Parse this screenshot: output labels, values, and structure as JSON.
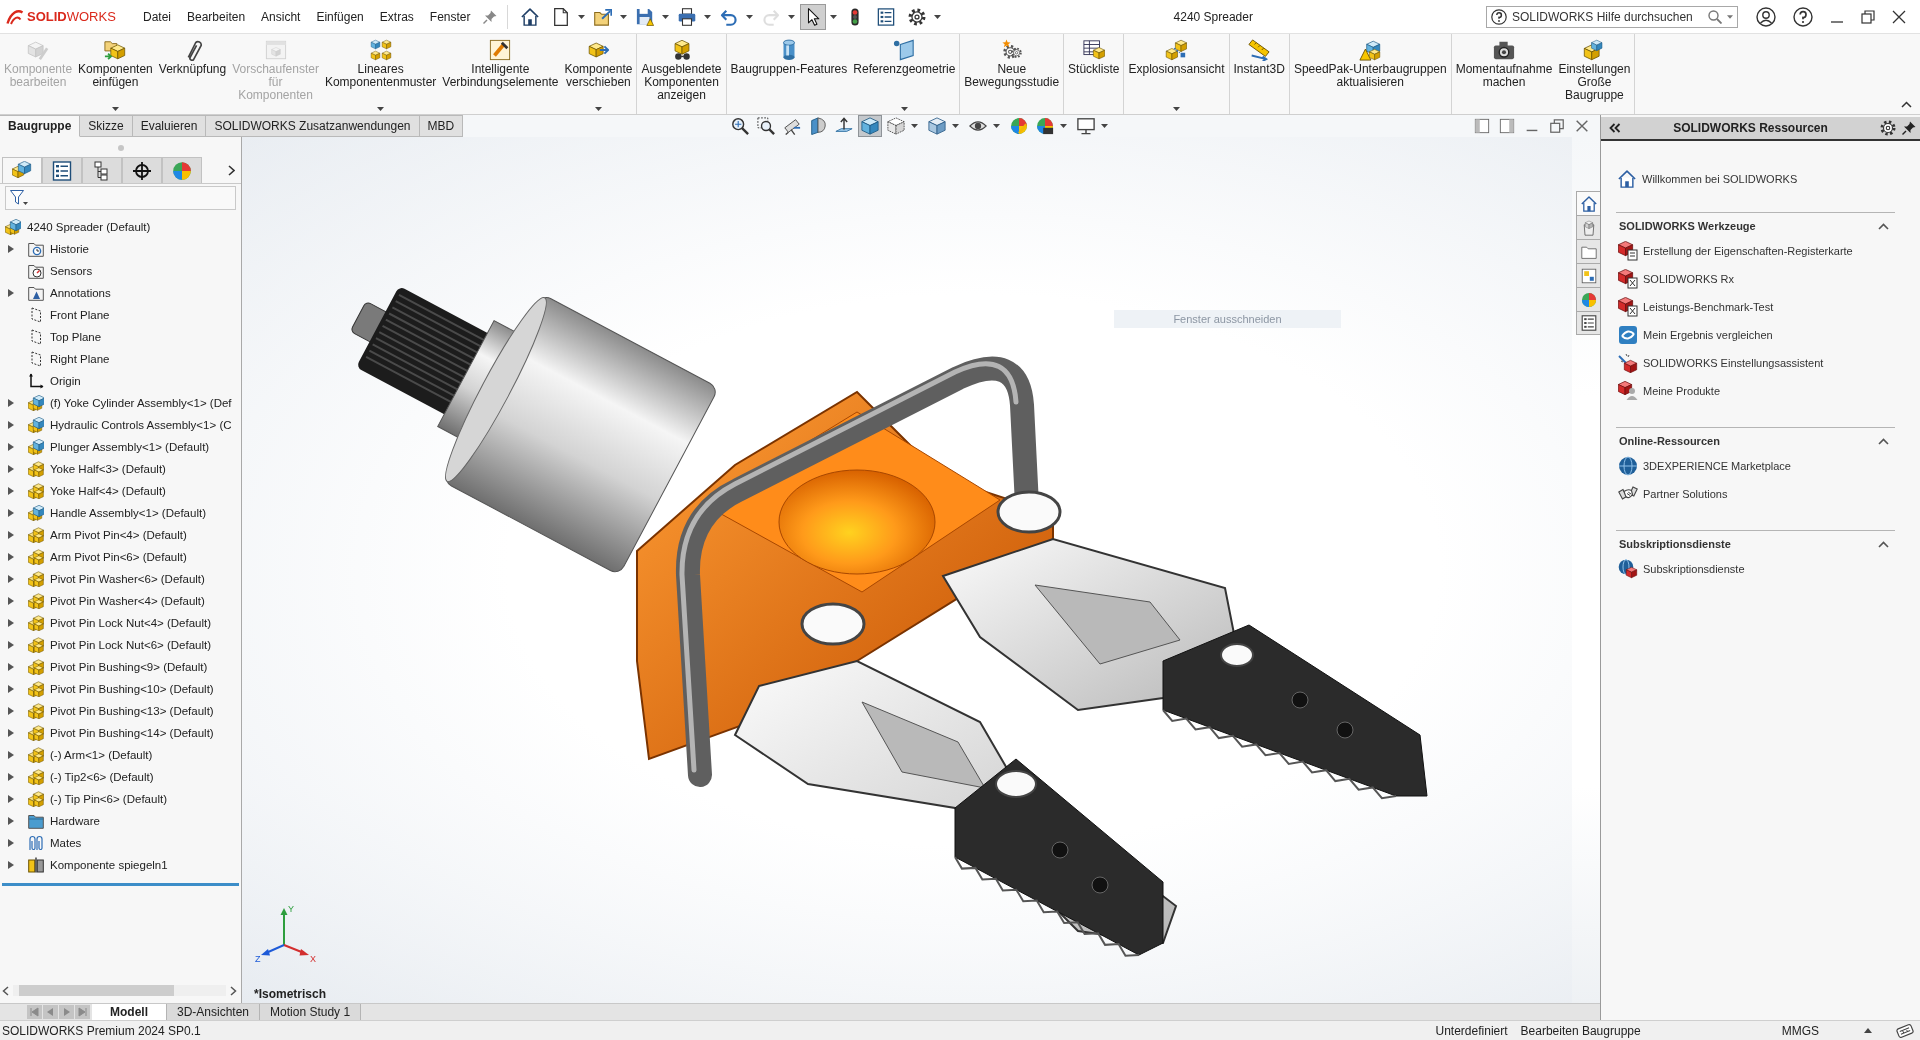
{
  "logo": "**SOLID**WORKS",
  "menu": [
    "Datei",
    "Bearbeiten",
    "Ansicht",
    "Einfügen",
    "Extras",
    "Fenster"
  ],
  "quick_access": [
    {
      "dropdown": false,
      "disabled": false,
      "selected": false
    },
    {
      "dropdown": true,
      "disabled": false,
      "selected": false
    },
    {
      "dropdown": true,
      "disabled": false,
      "selected": false
    },
    {
      "dropdown": true,
      "disabled": false,
      "selected": false
    },
    {
      "dropdown": true,
      "disabled": false,
      "selected": false
    },
    {
      "dropdown": true,
      "disabled": false,
      "selected": false
    },
    {
      "dropdown": true,
      "disabled": true,
      "selected": false
    },
    {
      "dropdown": true,
      "disabled": false,
      "selected": true
    },
    {
      "dropdown": false,
      "disabled": false,
      "selected": false
    },
    {
      "dropdown": false,
      "disabled": false,
      "selected": false
    },
    {
      "dropdown": true,
      "disabled": false,
      "selected": false
    }
  ],
  "window_title": "4240 Spreader",
  "search": {
    "placeholder": "SOLIDWORKS Hilfe durchsuchen"
  },
  "ribbon": {
    "groups": [
      {
        "commands": [
          {
            "label": "Komponente\nbearbeiten",
            "disabled": true,
            "dropdown": false
          },
          {
            "label": "Komponenten\neinfügen",
            "disabled": false,
            "dropdown": true
          },
          {
            "label": "Verknüpfung",
            "disabled": false,
            "dropdown": false
          },
          {
            "label": "Vorschaufenster\nfür\nKomponenten",
            "disabled": true,
            "dropdown": false
          },
          {
            "label": "Lineares\nKomponentenmuster",
            "disabled": false,
            "dropdown": true
          },
          {
            "label": "Intelligente\nVerbindungselemente",
            "disabled": false,
            "dropdown": false
          },
          {
            "label": "Komponente\nverschieben",
            "disabled": false,
            "dropdown": true
          }
        ]
      },
      {
        "commands": [
          {
            "label": "Ausgeblendete\nKomponenten\nanzeigen",
            "disabled": false,
            "dropdown": false
          }
        ]
      },
      {
        "commands": [
          {
            "label": "Baugruppen-Features",
            "disabled": false,
            "dropdown": false
          },
          {
            "label": "Referenzgeometrie",
            "disabled": false,
            "dropdown": true
          }
        ]
      },
      {
        "commands": [
          {
            "label": "Neue\nBewegungsstudie",
            "disabled": false,
            "dropdown": false
          }
        ]
      },
      {
        "commands": [
          {
            "label": "Stückliste",
            "disabled": false,
            "dropdown": false
          }
        ]
      },
      {
        "commands": [
          {
            "label": "Explosionsansicht",
            "disabled": false,
            "dropdown": true
          }
        ]
      },
      {
        "commands": [
          {
            "label": "Instant3D",
            "disabled": false,
            "dropdown": false
          }
        ]
      },
      {
        "commands": [
          {
            "label": "SpeedPak-Unterbaugruppen\naktualisieren",
            "disabled": false,
            "dropdown": false
          }
        ]
      },
      {
        "commands": [
          {
            "label": "Momentaufnahme\nmachen",
            "disabled": false,
            "dropdown": false
          },
          {
            "label": "Einstellungen\nGroße\nBaugruppe",
            "disabled": false,
            "dropdown": false
          }
        ]
      }
    ]
  },
  "command_tabs": [
    {
      "label": "Baugruppe",
      "selected": true
    },
    {
      "label": "Skizze",
      "selected": false
    },
    {
      "label": "Evaluieren",
      "selected": false
    },
    {
      "label": "SOLIDWORKS Zusatzanwendungen",
      "selected": false
    },
    {
      "label": "MBD",
      "selected": false
    }
  ],
  "feature_manager": {
    "tabs": [
      {
        "selected": true
      },
      {
        "selected": false
      },
      {
        "selected": false
      },
      {
        "selected": false
      },
      {
        "selected": false
      }
    ],
    "tree": {
      "label": "4240 Spreader (Default)",
      "kind": "assembly",
      "children": [
        {
          "label": "Historie",
          "kind": "history",
          "expanded": false
        },
        {
          "label": "Sensors",
          "kind": "sensors"
        },
        {
          "label": "Annotations",
          "kind": "annotations",
          "expanded": false
        },
        {
          "label": "Front Plane",
          "kind": "plane"
        },
        {
          "label": "Top Plane",
          "kind": "plane"
        },
        {
          "label": "Right Plane",
          "kind": "plane"
        },
        {
          "label": "Origin",
          "kind": "origin"
        },
        {
          "label": "(f) Yoke Cylinder Assembly<1> (Def",
          "kind": "assembly",
          "expanded": false
        },
        {
          "label": "Hydraulic Controls Assembly<1> (C",
          "kind": "assembly",
          "expanded": false
        },
        {
          "label": "Plunger Assembly<1> (Default)",
          "kind": "assembly",
          "expanded": false
        },
        {
          "label": "Yoke Half<3> (Default)",
          "kind": "part",
          "expanded": false
        },
        {
          "label": "Yoke Half<4> (Default)",
          "kind": "part",
          "expanded": false
        },
        {
          "label": "Handle Assembly<1> (Default)",
          "kind": "assembly",
          "expanded": false
        },
        {
          "label": "Arm Pivot Pin<4> (Default)",
          "kind": "part",
          "expanded": false
        },
        {
          "label": "Arm Pivot Pin<6> (Default)",
          "kind": "part",
          "expanded": false
        },
        {
          "label": "Pivot Pin Washer<6> (Default)",
          "kind": "part",
          "expanded": false
        },
        {
          "label": "Pivot Pin Washer<4> (Default)",
          "kind": "part",
          "expanded": false
        },
        {
          "label": "Pivot Pin Lock Nut<4> (Default)",
          "kind": "part",
          "expanded": false
        },
        {
          "label": "Pivot Pin Lock Nut<6> (Default)",
          "kind": "part",
          "expanded": false
        },
        {
          "label": "Pivot Pin Bushing<9> (Default)",
          "kind": "part",
          "expanded": false
        },
        {
          "label": "Pivot Pin Bushing<10> (Default)",
          "kind": "part",
          "expanded": false
        },
        {
          "label": "Pivot Pin Bushing<13> (Default)",
          "kind": "part",
          "expanded": false
        },
        {
          "label": "Pivot Pin Bushing<14> (Default)",
          "kind": "part",
          "expanded": false
        },
        {
          "label": "(-) Arm<1> (Default)",
          "kind": "part",
          "expanded": false
        },
        {
          "label": "(-) Tip2<6> (Default)",
          "kind": "part",
          "expanded": false
        },
        {
          "label": "(-) Tip Pin<6> (Default)",
          "kind": "part",
          "expanded": false
        },
        {
          "label": "Hardware",
          "kind": "folder",
          "expanded": false
        },
        {
          "label": "Mates",
          "kind": "mates",
          "expanded": false
        },
        {
          "label": "Komponente spiegeln1",
          "kind": "mirror",
          "expanded": false
        }
      ]
    }
  },
  "viewport": {
    "view_toolbar": [
      {
        "dropdown": false,
        "selected": false
      },
      {
        "dropdown": false,
        "selected": false
      },
      {
        "dropdown": false,
        "selected": false
      },
      {
        "dropdown": false,
        "selected": false
      },
      {
        "dropdown": false,
        "selected": false
      },
      {
        "dropdown": false,
        "selected": true
      },
      {
        "dropdown": true,
        "selected": false
      },
      {
        "dropdown": true,
        "selected": false
      },
      {
        "dropdown": true,
        "selected": false
      },
      {
        "dropdown": false,
        "selected": false
      },
      {
        "dropdown": true,
        "selected": false
      },
      {
        "dropdown": true,
        "selected": false
      }
    ],
    "hint": "Fenster ausschneiden",
    "view_name": "*Isometrisch",
    "triad_labels": {
      "x": "X",
      "y": "Y",
      "z": "Z"
    }
  },
  "bottom_tabs": [
    {
      "label": "Modell",
      "selected": true
    },
    {
      "label": "3D-Ansichten",
      "selected": false
    },
    {
      "label": "Motion Study 1",
      "selected": false
    }
  ],
  "task_pane": {
    "tabs": [
      {
        "selected": true
      },
      {
        "selected": false
      },
      {
        "selected": false
      },
      {
        "selected": false
      },
      {
        "selected": false
      },
      {
        "selected": false
      }
    ],
    "title": "SOLIDWORKS Ressourcen",
    "welcome": "Willkommen bei SOLIDWORKS",
    "sections": [
      {
        "title": "SOLIDWORKS Werkzeuge",
        "expanded": true,
        "items": [
          "Erstellung der Eigenschaften-Registerkarte",
          "SOLIDWORKS Rx",
          "Leistungs-Benchmark-Test",
          "Mein Ergebnis vergleichen",
          "SOLIDWORKS Einstellungsassistent",
          "Meine Produkte"
        ]
      },
      {
        "title": "Online-Ressourcen",
        "expanded": true,
        "items": [
          "3DEXPERIENCE Marketplace",
          "Partner Solutions"
        ]
      },
      {
        "title": "Subskriptionsdienste",
        "expanded": true,
        "items": [
          "Subskriptionsdienste"
        ]
      }
    ]
  },
  "status_bar": {
    "product": "SOLIDWORKS Premium 2024 SP0.1",
    "state": "Unterdefiniert",
    "mode": "Bearbeiten Baugruppe",
    "units": "MMGS"
  }
}
